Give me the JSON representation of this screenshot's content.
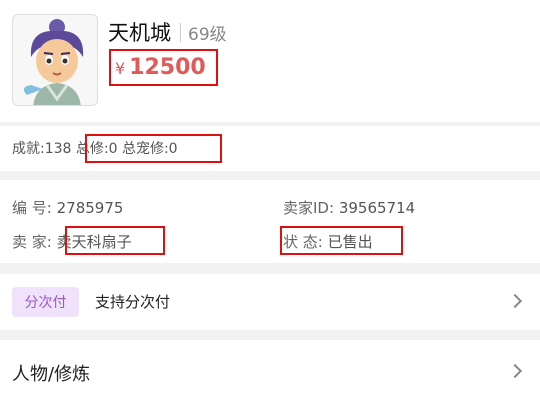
{
  "header": {
    "server_name": "天机城",
    "level": "69级",
    "price_symbol": "¥",
    "price": "12500"
  },
  "achievement": {
    "text": "成就:138 总修:0 总宠修:0"
  },
  "info": {
    "id_label": "编 号:",
    "id_value": "2785975",
    "seller_id_label": "卖家ID:",
    "seller_id_value": "39565714",
    "seller_label": "卖 家:",
    "seller_value": "卖天科扇子",
    "status_label": "状 态:",
    "status_value": "已售出"
  },
  "installment": {
    "badge": "分次付",
    "text": "支持分次付"
  },
  "character": {
    "label": "人物/修炼"
  },
  "colors": {
    "price": "#e05a5a",
    "highlight_box": "#e01010",
    "badge_bg": "#f0e2fa",
    "badge_text": "#9b58c8"
  }
}
